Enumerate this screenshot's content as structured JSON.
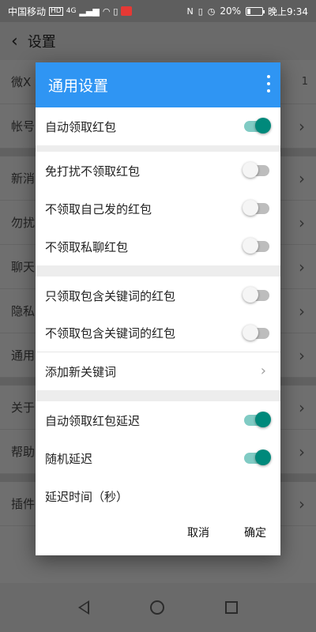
{
  "status": {
    "carrier": "中国移动",
    "hd": "HD",
    "network": "4G",
    "battery_percent": "20%",
    "battery_level": 0.2,
    "time": "晚上9:34"
  },
  "app": {
    "back_icon": "chevron-left-icon",
    "title": "设置"
  },
  "background_rows": [
    {
      "label": "微X",
      "trail": "1"
    },
    {
      "label": "帐号",
      "trail": ""
    },
    {
      "label": "新消",
      "trail": ""
    },
    {
      "label": "勿扰",
      "trail": ""
    },
    {
      "label": "聊天",
      "trail": ""
    },
    {
      "label": "隐私",
      "trail": ""
    },
    {
      "label": "通用",
      "trail": ""
    },
    {
      "label": "关于",
      "trail": ""
    },
    {
      "label": "帮助",
      "trail": ""
    },
    {
      "label": "插件",
      "trail": ""
    }
  ],
  "dialog": {
    "title": "通用设置",
    "more_icon": "more-vert-icon",
    "items": [
      {
        "label": "自动领取红包",
        "toggle": true
      },
      {
        "label": "免打扰不领取红包",
        "toggle": false
      },
      {
        "label": "不领取自己发的红包",
        "toggle": false
      },
      {
        "label": "不领取私聊红包",
        "toggle": false
      },
      {
        "label": "只领取包含关键词的红包",
        "toggle": false
      },
      {
        "label": "不领取包含关键词的红包",
        "toggle": false
      },
      {
        "label": "添加新关键词"
      },
      {
        "label": "自动领取红包延迟",
        "toggle": true
      },
      {
        "label": "随机延迟",
        "toggle": true
      },
      {
        "label": "延迟时间（秒）"
      }
    ],
    "cancel_label": "取消",
    "ok_label": "确定"
  },
  "colors": {
    "header": "#2f95f3",
    "toggle_on": "#00897b",
    "toggle_off": "#bdbdbd"
  }
}
